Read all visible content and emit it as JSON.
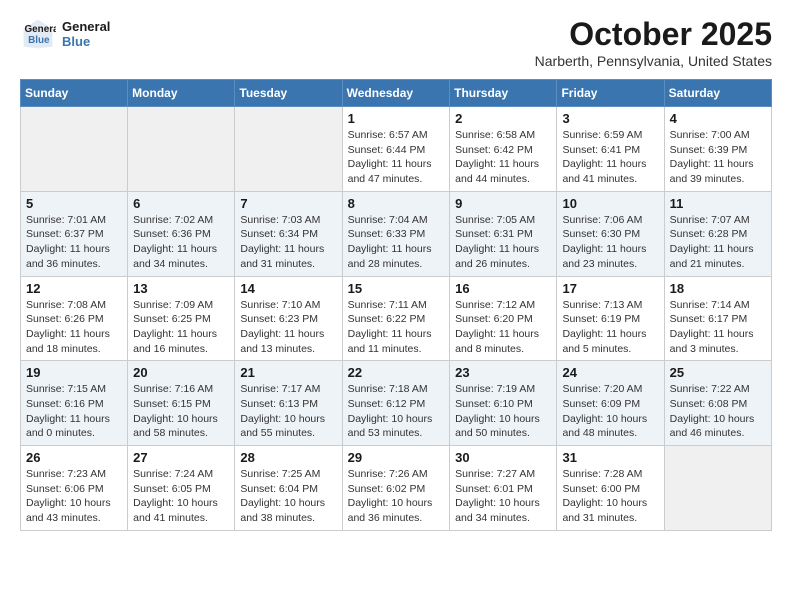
{
  "header": {
    "logo_line1": "General",
    "logo_line2": "Blue",
    "month": "October 2025",
    "location": "Narberth, Pennsylvania, United States"
  },
  "days_of_week": [
    "Sunday",
    "Monday",
    "Tuesday",
    "Wednesday",
    "Thursday",
    "Friday",
    "Saturday"
  ],
  "weeks": [
    [
      {
        "day": "",
        "info": ""
      },
      {
        "day": "",
        "info": ""
      },
      {
        "day": "",
        "info": ""
      },
      {
        "day": "1",
        "info": "Sunrise: 6:57 AM\nSunset: 6:44 PM\nDaylight: 11 hours\nand 47 minutes."
      },
      {
        "day": "2",
        "info": "Sunrise: 6:58 AM\nSunset: 6:42 PM\nDaylight: 11 hours\nand 44 minutes."
      },
      {
        "day": "3",
        "info": "Sunrise: 6:59 AM\nSunset: 6:41 PM\nDaylight: 11 hours\nand 41 minutes."
      },
      {
        "day": "4",
        "info": "Sunrise: 7:00 AM\nSunset: 6:39 PM\nDaylight: 11 hours\nand 39 minutes."
      }
    ],
    [
      {
        "day": "5",
        "info": "Sunrise: 7:01 AM\nSunset: 6:37 PM\nDaylight: 11 hours\nand 36 minutes."
      },
      {
        "day": "6",
        "info": "Sunrise: 7:02 AM\nSunset: 6:36 PM\nDaylight: 11 hours\nand 34 minutes."
      },
      {
        "day": "7",
        "info": "Sunrise: 7:03 AM\nSunset: 6:34 PM\nDaylight: 11 hours\nand 31 minutes."
      },
      {
        "day": "8",
        "info": "Sunrise: 7:04 AM\nSunset: 6:33 PM\nDaylight: 11 hours\nand 28 minutes."
      },
      {
        "day": "9",
        "info": "Sunrise: 7:05 AM\nSunset: 6:31 PM\nDaylight: 11 hours\nand 26 minutes."
      },
      {
        "day": "10",
        "info": "Sunrise: 7:06 AM\nSunset: 6:30 PM\nDaylight: 11 hours\nand 23 minutes."
      },
      {
        "day": "11",
        "info": "Sunrise: 7:07 AM\nSunset: 6:28 PM\nDaylight: 11 hours\nand 21 minutes."
      }
    ],
    [
      {
        "day": "12",
        "info": "Sunrise: 7:08 AM\nSunset: 6:26 PM\nDaylight: 11 hours\nand 18 minutes."
      },
      {
        "day": "13",
        "info": "Sunrise: 7:09 AM\nSunset: 6:25 PM\nDaylight: 11 hours\nand 16 minutes."
      },
      {
        "day": "14",
        "info": "Sunrise: 7:10 AM\nSunset: 6:23 PM\nDaylight: 11 hours\nand 13 minutes."
      },
      {
        "day": "15",
        "info": "Sunrise: 7:11 AM\nSunset: 6:22 PM\nDaylight: 11 hours\nand 11 minutes."
      },
      {
        "day": "16",
        "info": "Sunrise: 7:12 AM\nSunset: 6:20 PM\nDaylight: 11 hours\nand 8 minutes."
      },
      {
        "day": "17",
        "info": "Sunrise: 7:13 AM\nSunset: 6:19 PM\nDaylight: 11 hours\nand 5 minutes."
      },
      {
        "day": "18",
        "info": "Sunrise: 7:14 AM\nSunset: 6:17 PM\nDaylight: 11 hours\nand 3 minutes."
      }
    ],
    [
      {
        "day": "19",
        "info": "Sunrise: 7:15 AM\nSunset: 6:16 PM\nDaylight: 11 hours\nand 0 minutes."
      },
      {
        "day": "20",
        "info": "Sunrise: 7:16 AM\nSunset: 6:15 PM\nDaylight: 10 hours\nand 58 minutes."
      },
      {
        "day": "21",
        "info": "Sunrise: 7:17 AM\nSunset: 6:13 PM\nDaylight: 10 hours\nand 55 minutes."
      },
      {
        "day": "22",
        "info": "Sunrise: 7:18 AM\nSunset: 6:12 PM\nDaylight: 10 hours\nand 53 minutes."
      },
      {
        "day": "23",
        "info": "Sunrise: 7:19 AM\nSunset: 6:10 PM\nDaylight: 10 hours\nand 50 minutes."
      },
      {
        "day": "24",
        "info": "Sunrise: 7:20 AM\nSunset: 6:09 PM\nDaylight: 10 hours\nand 48 minutes."
      },
      {
        "day": "25",
        "info": "Sunrise: 7:22 AM\nSunset: 6:08 PM\nDaylight: 10 hours\nand 46 minutes."
      }
    ],
    [
      {
        "day": "26",
        "info": "Sunrise: 7:23 AM\nSunset: 6:06 PM\nDaylight: 10 hours\nand 43 minutes."
      },
      {
        "day": "27",
        "info": "Sunrise: 7:24 AM\nSunset: 6:05 PM\nDaylight: 10 hours\nand 41 minutes."
      },
      {
        "day": "28",
        "info": "Sunrise: 7:25 AM\nSunset: 6:04 PM\nDaylight: 10 hours\nand 38 minutes."
      },
      {
        "day": "29",
        "info": "Sunrise: 7:26 AM\nSunset: 6:02 PM\nDaylight: 10 hours\nand 36 minutes."
      },
      {
        "day": "30",
        "info": "Sunrise: 7:27 AM\nSunset: 6:01 PM\nDaylight: 10 hours\nand 34 minutes."
      },
      {
        "day": "31",
        "info": "Sunrise: 7:28 AM\nSunset: 6:00 PM\nDaylight: 10 hours\nand 31 minutes."
      },
      {
        "day": "",
        "info": ""
      }
    ]
  ]
}
